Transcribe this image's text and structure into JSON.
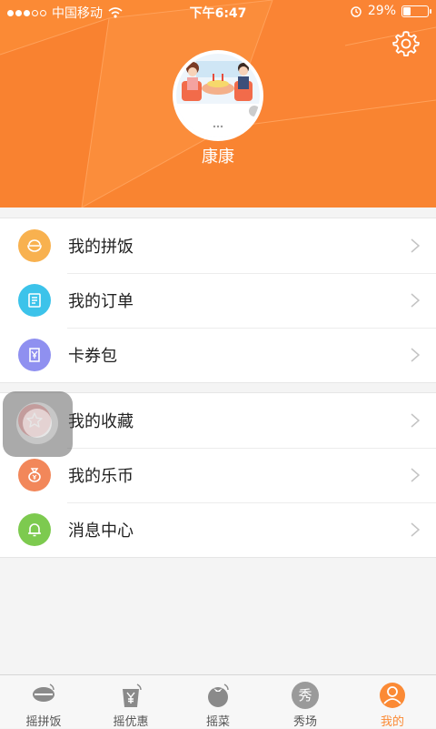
{
  "status_bar": {
    "carrier": "中国移动",
    "time": "下午6:47",
    "battery": "29%",
    "battery_level": 0.29
  },
  "profile": {
    "username": "康康"
  },
  "menu_group_1": [
    {
      "label": "我的拼饭",
      "icon": "bowl-icon",
      "color": "#f8b14f"
    },
    {
      "label": "我的订单",
      "icon": "order-icon",
      "color": "#3cc3ea"
    },
    {
      "label": "卡券包",
      "icon": "coupon-icon",
      "color": "#8f90f0"
    }
  ],
  "menu_group_2": [
    {
      "label": "我的收藏",
      "icon": "star-icon",
      "color": "#f06a6a"
    },
    {
      "label": "我的乐币",
      "icon": "money-bag-icon",
      "color": "#f2875a"
    },
    {
      "label": "消息中心",
      "icon": "bell-icon",
      "color": "#7dca4f"
    }
  ],
  "tabs": [
    {
      "label": "摇拼饭",
      "icon": "bowl-tab-icon",
      "active": false
    },
    {
      "label": "摇优惠",
      "icon": "yen-tab-icon",
      "active": false
    },
    {
      "label": "摇菜",
      "icon": "tomato-tab-icon",
      "active": false
    },
    {
      "label": "秀场",
      "icon": "show-tab-icon",
      "icon_text": "秀",
      "active": false
    },
    {
      "label": "我的",
      "icon": "profile-tab-icon",
      "active": true
    }
  ],
  "colors": {
    "accent": "#fb8a35"
  }
}
